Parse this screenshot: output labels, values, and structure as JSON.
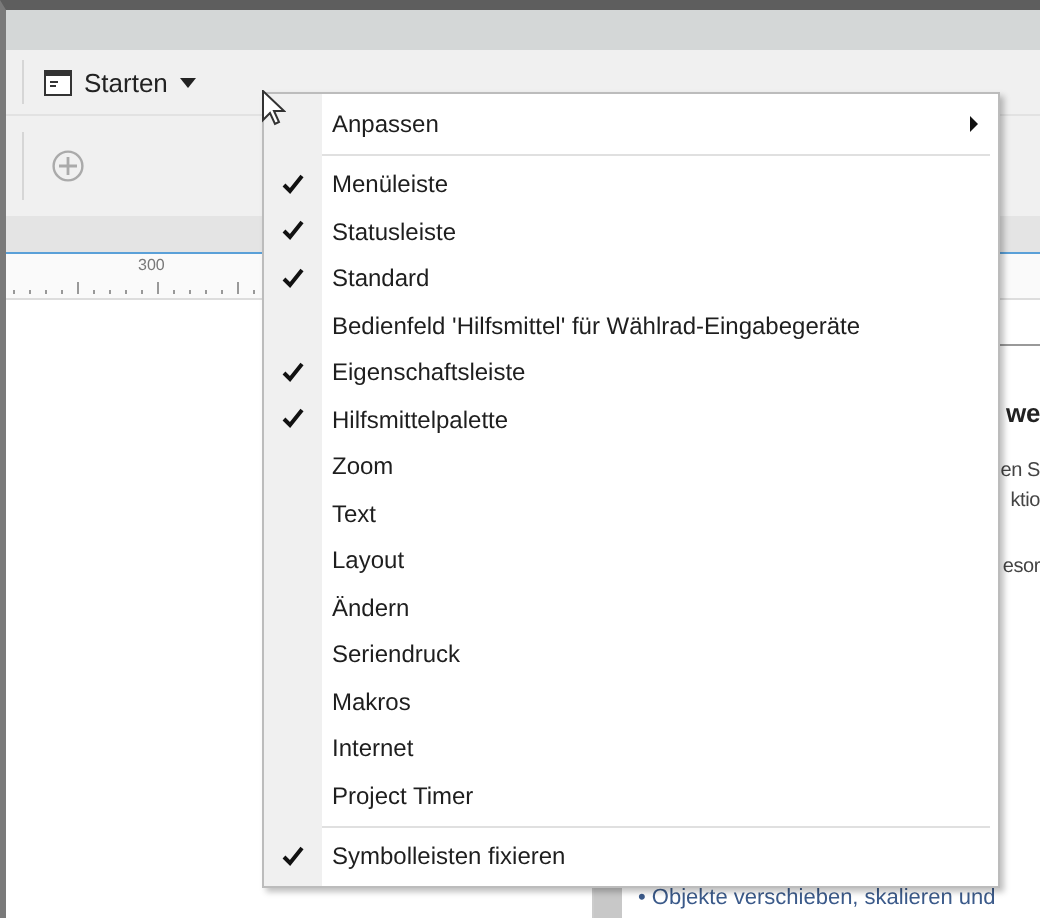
{
  "toolbar": {
    "start_button": {
      "label": "Starten"
    }
  },
  "ruler": {
    "label": "300"
  },
  "panel": {
    "heading": "we",
    "lines": [
      "en S",
      "ktio",
      "esor"
    ],
    "bullet": "• Objekte verschieben, skalieren und"
  },
  "context_menu": {
    "items": [
      {
        "kind": "submenu",
        "label": "Anpassen"
      },
      {
        "kind": "separator"
      },
      {
        "kind": "check",
        "label": "Menüleiste",
        "checked": true
      },
      {
        "kind": "check",
        "label": "Statusleiste",
        "checked": true
      },
      {
        "kind": "check",
        "label": "Standard",
        "checked": true
      },
      {
        "kind": "check",
        "label": "Bedienfeld 'Hilfsmittel' für Wählrad-Eingabegeräte",
        "checked": false
      },
      {
        "kind": "check",
        "label": "Eigenschaftsleiste",
        "checked": true
      },
      {
        "kind": "check",
        "label": "Hilfsmittelpalette",
        "checked": true
      },
      {
        "kind": "check",
        "label": "Zoom",
        "checked": false
      },
      {
        "kind": "check",
        "label": "Text",
        "checked": false
      },
      {
        "kind": "check",
        "label": "Layout",
        "checked": false
      },
      {
        "kind": "check",
        "label": "Ändern",
        "checked": false
      },
      {
        "kind": "check",
        "label": "Seriendruck",
        "checked": false
      },
      {
        "kind": "check",
        "label": "Makros",
        "checked": false
      },
      {
        "kind": "check",
        "label": "Internet",
        "checked": false
      },
      {
        "kind": "check",
        "label": "Project Timer",
        "checked": false
      },
      {
        "kind": "separator"
      },
      {
        "kind": "check",
        "label": "Symbolleisten fixieren",
        "checked": true
      }
    ]
  }
}
